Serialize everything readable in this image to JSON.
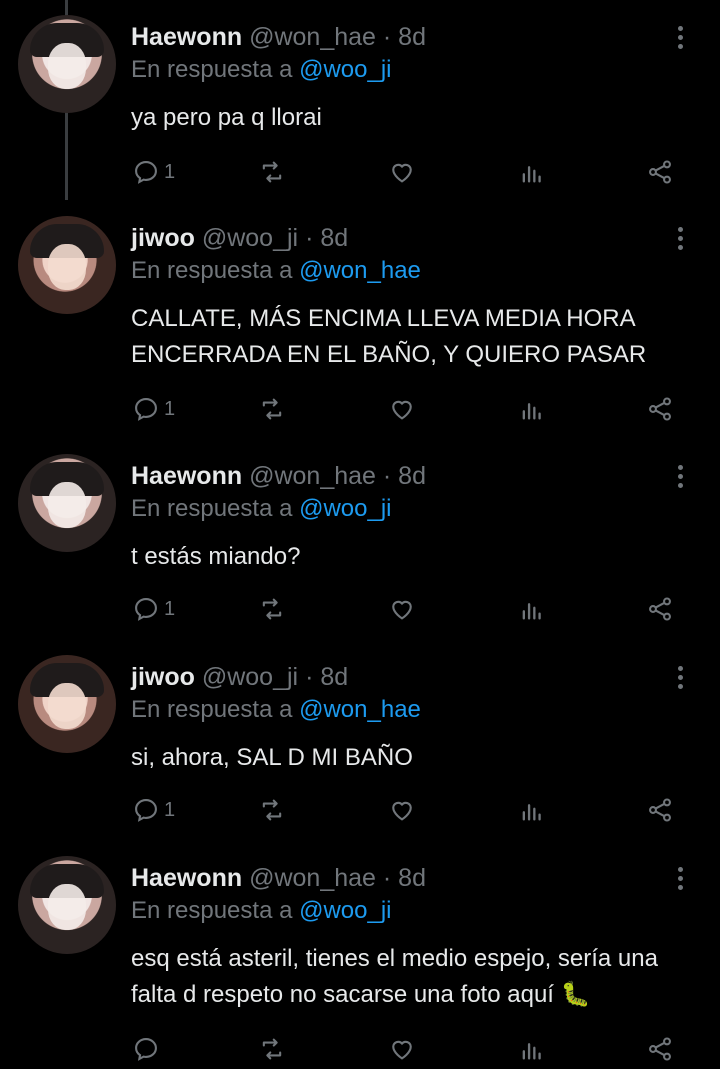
{
  "tweets": [
    {
      "name": "Haewonn",
      "handle": "@won_hae",
      "time": "8d",
      "reply_prefix": "En respuesta a",
      "reply_to": "@woo_ji",
      "text": "ya pero pa q llorai",
      "replies": "1"
    },
    {
      "name": "jiwoo",
      "handle": "@woo_ji",
      "time": "8d",
      "reply_prefix": "En respuesta a",
      "reply_to": "@won_hae",
      "text": "CALLATE, MÁS ENCIMA LLEVA MEDIA HORA ENCERRADA EN EL BAÑO, Y QUIERO PASAR",
      "replies": "1"
    },
    {
      "name": "Haewonn",
      "handle": "@won_hae",
      "time": "8d",
      "reply_prefix": "En respuesta a",
      "reply_to": "@woo_ji",
      "text": "t estás miando?",
      "replies": "1"
    },
    {
      "name": "jiwoo",
      "handle": "@woo_ji",
      "time": "8d",
      "reply_prefix": "En respuesta a",
      "reply_to": "@won_hae",
      "text": "si, ahora, SAL D MI BAÑO",
      "replies": "1"
    },
    {
      "name": "Haewonn",
      "handle": "@won_hae",
      "time": "8d",
      "reply_prefix": "En respuesta a",
      "reply_to": "@woo_ji",
      "text": "esq está asteril, tienes el medio espejo, sería una falta d respeto no sacarse una foto aquí 🐛",
      "replies": ""
    }
  ],
  "icons": {
    "reply": "reply-icon",
    "retweet": "retweet-icon",
    "like": "heart-icon",
    "views": "analytics-icon",
    "share": "share-icon",
    "more": "more-icon"
  },
  "colors": {
    "background": "#000000",
    "text": "#e7e9ea",
    "muted": "#71767b",
    "link": "#1d9bf0"
  }
}
